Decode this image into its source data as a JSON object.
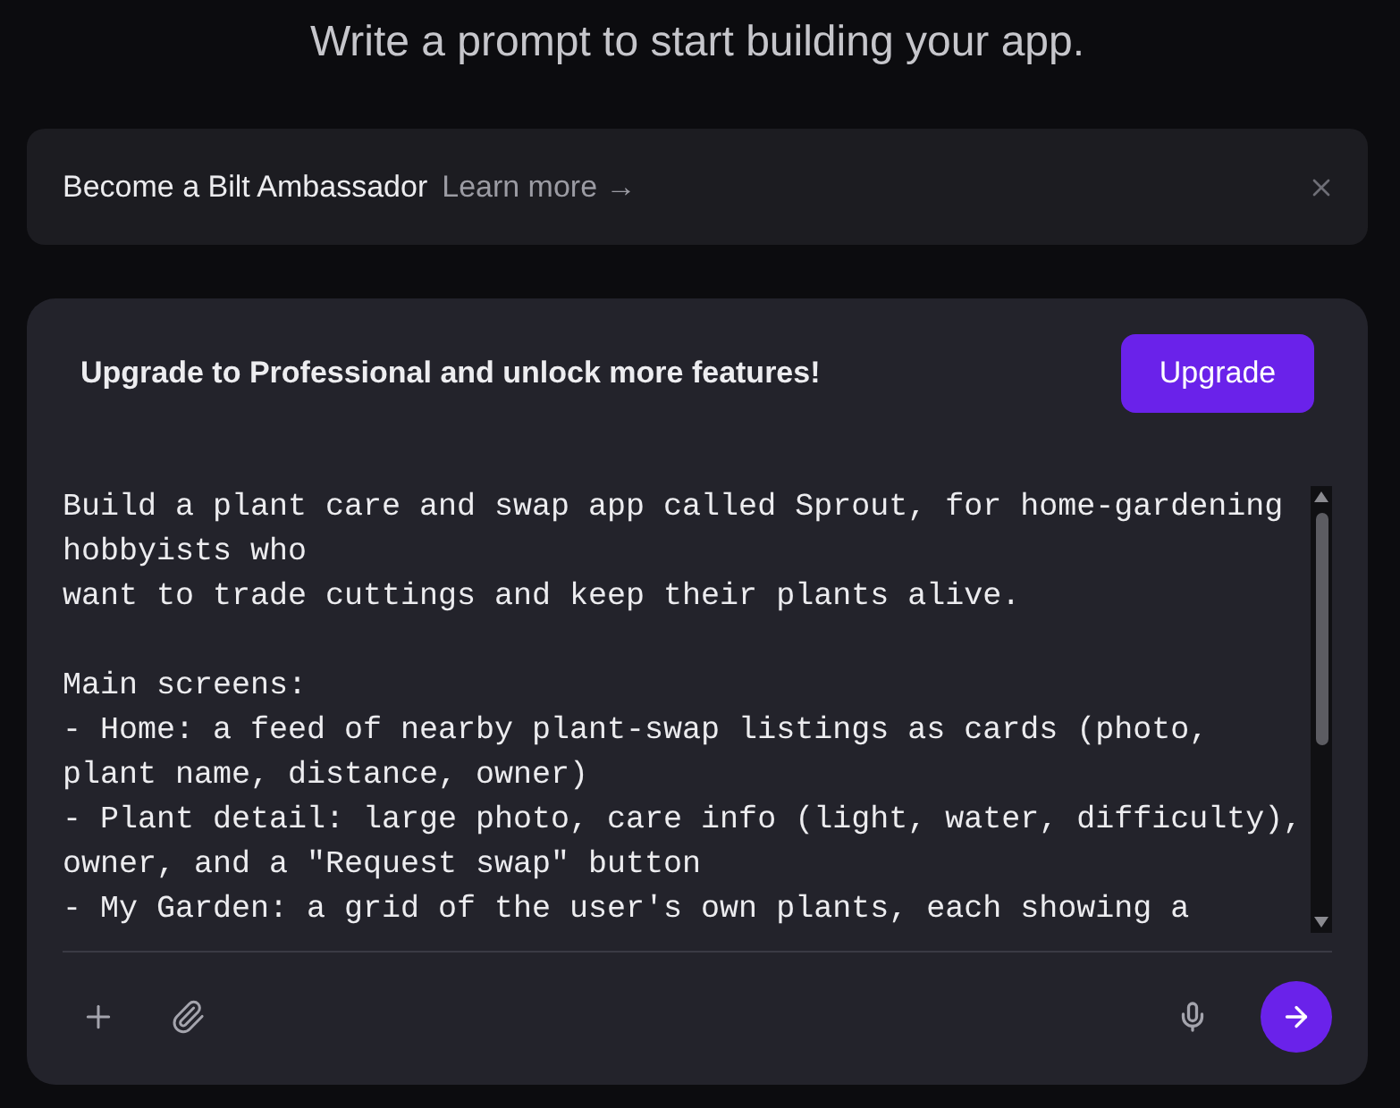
{
  "heading": "Write a prompt to start building your app.",
  "banner": {
    "title": "Become a Bilt Ambassador",
    "link": "Learn more →"
  },
  "composer": {
    "upgrade_message": "Upgrade to Professional and unlock more features!",
    "upgrade_button": "Upgrade",
    "prompt": {
      "value": "Build a plant care and swap app called Sprout, for home-gardening hobbyists who\nwant to trade cuttings and keep their plants alive.\n\nMain screens:\n- Home: a feed of nearby plant-swap listings as cards (photo, plant name, distance, owner)\n- Plant detail: large photo, care info (light, water, difficulty), owner, and a \"Request swap\" button\n- My Garden: a grid of the user's own plants, each showing a"
    }
  }
}
